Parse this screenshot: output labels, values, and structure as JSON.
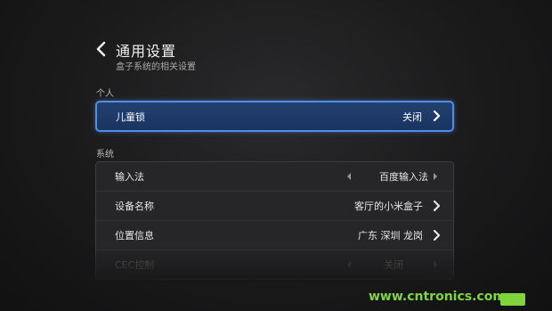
{
  "header": {
    "title": "通用设置",
    "subtitle": "盒子系统的相关设置"
  },
  "sections": {
    "personal": "个人",
    "system": "系统"
  },
  "personal_items": [
    {
      "label": "儿童锁",
      "value": "关闭"
    }
  ],
  "system_items": [
    {
      "label": "输入法",
      "value": "百度输入法"
    },
    {
      "label": "设备名称",
      "value": "客厅的小米盒子"
    },
    {
      "label": "位置信息",
      "value": "广东 深圳 龙岗"
    },
    {
      "label": "CEC控制",
      "value": "关闭"
    }
  ],
  "watermark": "www.cntronics.com",
  "colors": {
    "accent": "#4f8fe6",
    "selected_bg": "#22406f",
    "watermark": "#7fd53a"
  }
}
